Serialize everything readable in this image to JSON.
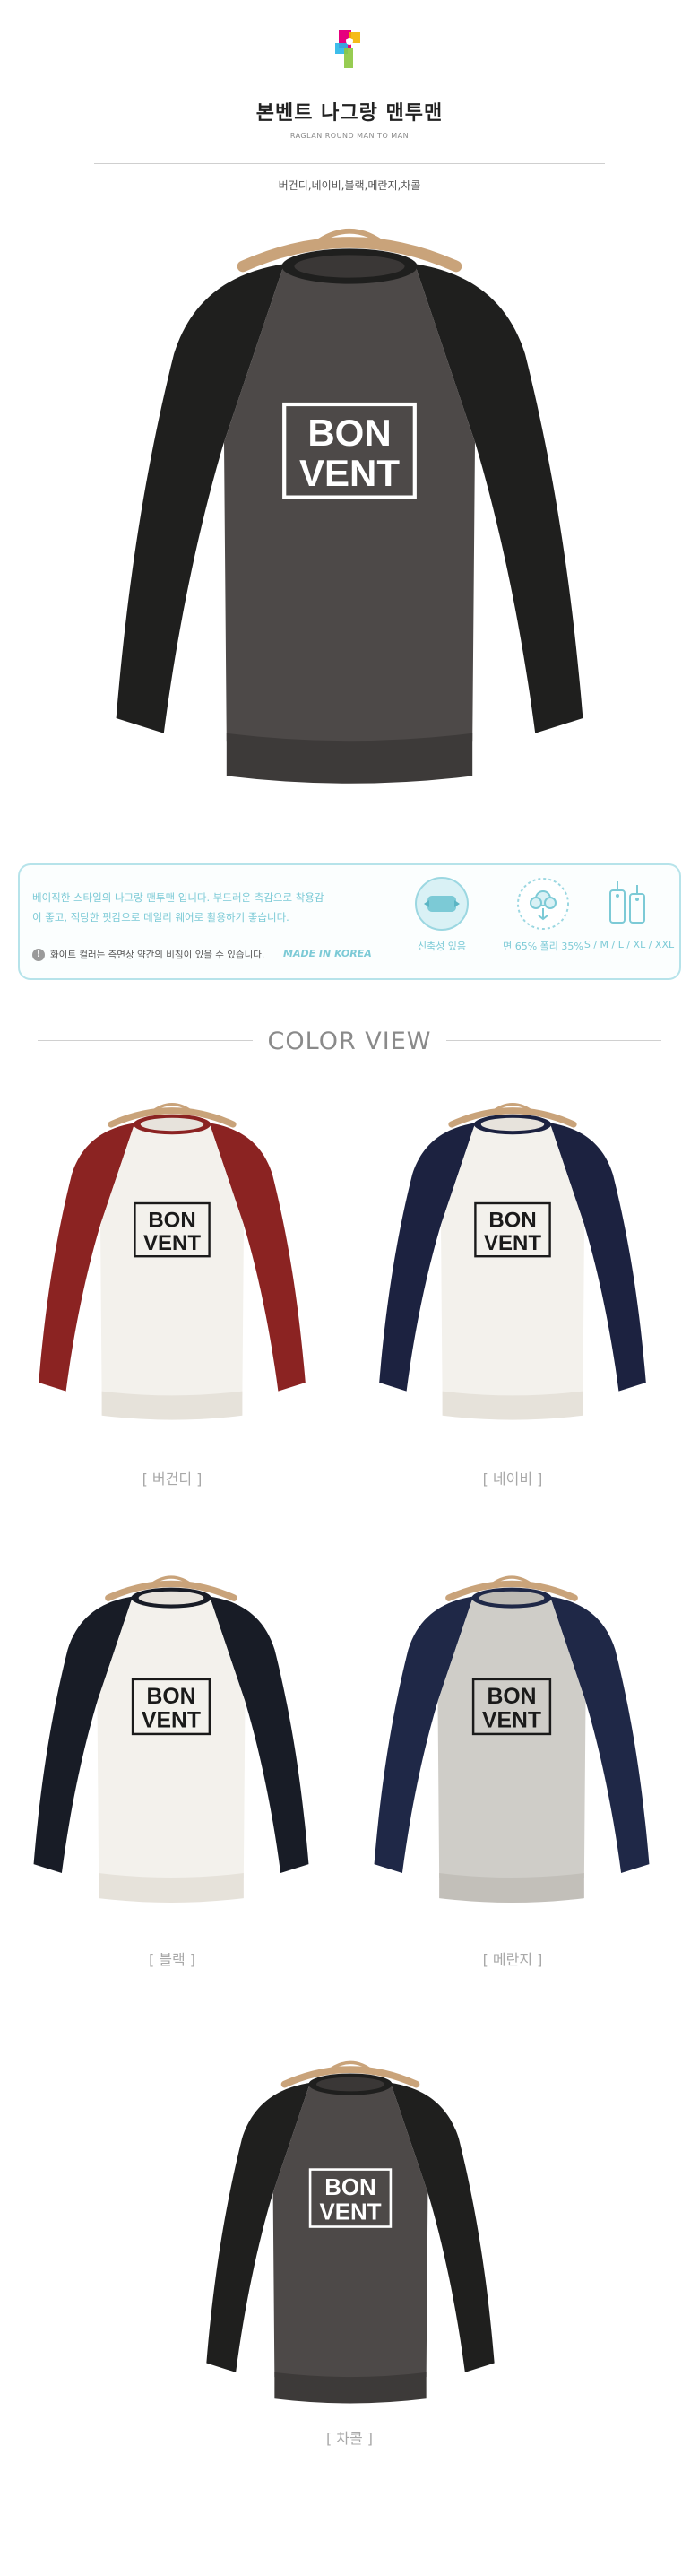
{
  "header": {
    "logo_icon": "brand-p-logo-icon",
    "title": "본벤트 나그랑 맨투맨",
    "subtitle": "RAGLAN ROUND MAN TO MAN",
    "colors_line": "버건디,네이비,블랙,메란지,차콜"
  },
  "info": {
    "description": "베이직한 스타일의 나그랑 맨투맨 입니다. 부드러운 촉감으로 착용감이 좋고, 적당한 핏감으로 데일리 웨어로 활용하기 좋습니다.",
    "warning": "화이트 컬러는 측면상 약간의 비침이 있을 수 있습니다.",
    "made_in": "MADE IN KOREA",
    "features": [
      {
        "icon": "stretch-pillow-icon",
        "label": "신축성 있음"
      },
      {
        "icon": "cotton-fabric-icon",
        "label": "면 65% 폴리 35%"
      },
      {
        "icon": "size-tag-icon",
        "label": "S / M / L / XL / XXL"
      }
    ]
  },
  "color_view": {
    "title": "COLOR VIEW",
    "captions": [
      "[ 버건디 ]",
      "[ 네이비 ]",
      "[ 블랙 ]",
      "[ 메란지 ]",
      "[ 차콜 ]"
    ]
  },
  "print_text": {
    "line1": "BON",
    "line2": "VENT"
  },
  "colors": {
    "accent": "#7ccad6",
    "charcoal_body": "#4d4948",
    "black_sleeve": "#1f1f1e",
    "burgundy": "#8b2322",
    "navy": "#1c2240",
    "ivory_body": "#f3f1ec",
    "melange_body": "#cfcdc8",
    "hanger": "#c9a37a"
  }
}
